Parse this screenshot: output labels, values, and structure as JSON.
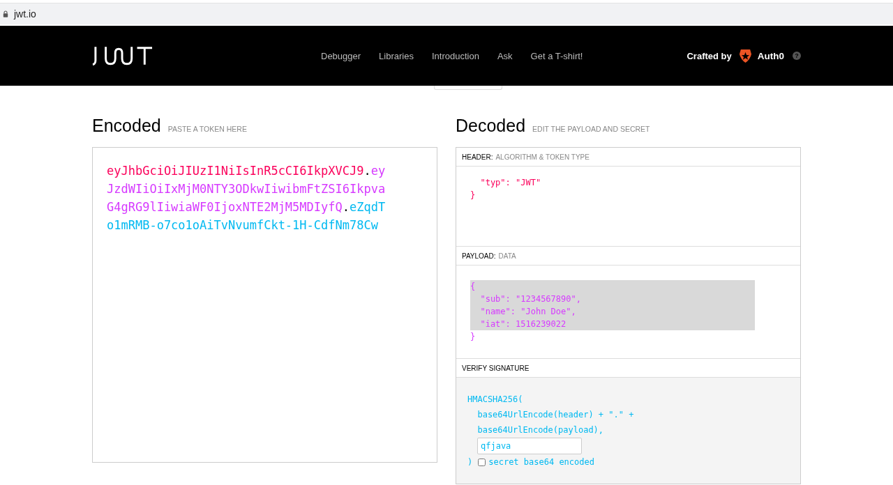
{
  "browser": {
    "url": "jwt.io",
    "secure": true
  },
  "nav": {
    "links": [
      "Debugger",
      "Libraries",
      "Introduction",
      "Ask",
      "Get a T-shirt!"
    ],
    "crafted_by": "Crafted by",
    "brand": "Auth0",
    "help": "?"
  },
  "encoded": {
    "title": "Encoded",
    "subtitle": "PASTE A TOKEN HERE",
    "lines": [
      [
        {
          "kind": "header",
          "text": "eyJhbGciOiJIUzI1NiIsInR5cCI6IkpXVCJ9"
        },
        {
          "kind": "dot",
          "text": "."
        },
        {
          "kind": "payload",
          "text": "ey"
        }
      ],
      [
        {
          "kind": "payload",
          "text": "JzdWIiOiIxMjM0NTY3ODkwIiwibmFtZSI6Ikpva"
        }
      ],
      [
        {
          "kind": "payload",
          "text": "G4gRG9lIiwiaWF0IjoxNTE2MjM5MDIyfQ"
        },
        {
          "kind": "dot",
          "text": "."
        },
        {
          "kind": "signature",
          "text": "eZqdT"
        }
      ],
      [
        {
          "kind": "signature",
          "text": "o1mRMB-o7co1oAiTvNvumfCkt-1H-CdfNm78Cw"
        }
      ]
    ]
  },
  "decoded": {
    "title": "Decoded",
    "subtitle": "EDIT THE PAYLOAD AND SECRET",
    "header": {
      "label": "HEADER:",
      "sublabel": "ALGORITHM & TOKEN TYPE",
      "lines": [
        {
          "text": "  \"typ\": \"JWT\""
        },
        {
          "text": "}"
        }
      ]
    },
    "payload": {
      "label": "PAYLOAD:",
      "sublabel": "DATA",
      "lines": [
        {
          "text": "{",
          "selected": true
        },
        {
          "text": "  \"sub\": \"1234567890\",",
          "selected": true
        },
        {
          "text": "  \"name\": \"John Doe\",",
          "selected": true
        },
        {
          "text": "  \"iat\": 1516239022",
          "selected": true
        },
        {
          "text": "}",
          "selected": false
        }
      ]
    },
    "verify": {
      "label": "VERIFY SIGNATURE",
      "lines": [
        "HMACSHA256(",
        "  base64UrlEncode(header) + \".\" +",
        "  base64UrlEncode(payload),"
      ],
      "secret": "qfjava",
      "close": ")",
      "checkbox_label": "secret base64 encoded",
      "checked": false
    }
  }
}
